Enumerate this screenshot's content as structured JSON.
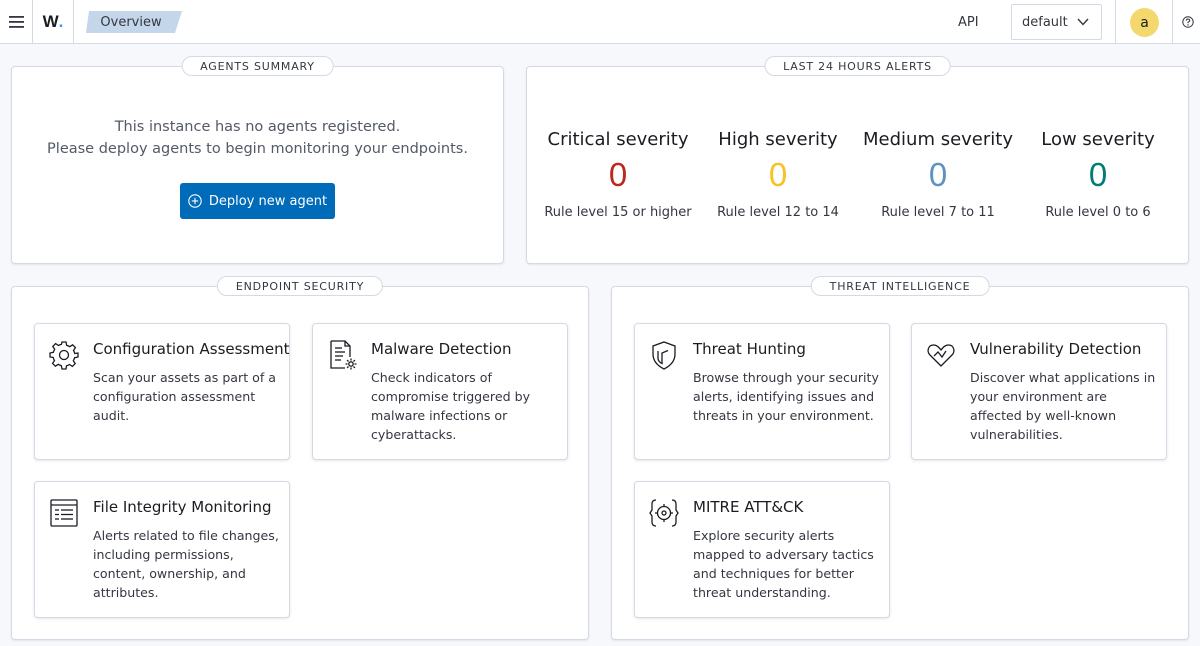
{
  "header": {
    "logo_text": "W",
    "logo_dot": ".",
    "breadcrumb": "Overview",
    "api_label": "API",
    "selector_value": "default",
    "avatar_initial": "a",
    "icons": [
      "menu-icon",
      "chevron-down-icon",
      "help-icon"
    ]
  },
  "agents_summary": {
    "title": "AGENTS SUMMARY",
    "line1": "This instance has no agents registered.",
    "line2": "Please deploy agents to begin monitoring your endpoints.",
    "button_label": "Deploy new agent",
    "button_icon": "plus-circle-icon"
  },
  "alerts": {
    "title": "LAST 24 HOURS ALERTS",
    "items": [
      {
        "label": "Critical severity",
        "value": "0",
        "rule": "Rule level 15 or higher",
        "color": "#bd271e"
      },
      {
        "label": "High severity",
        "value": "0",
        "rule": "Rule level 12 to 14",
        "color": "#f5c324"
      },
      {
        "label": "Medium severity",
        "value": "0",
        "rule": "Rule level 7 to 11",
        "color": "#6092c0"
      },
      {
        "label": "Low severity",
        "value": "0",
        "rule": "Rule level 0 to 6",
        "color": "#017d73"
      }
    ]
  },
  "endpoint_security": {
    "title": "ENDPOINT SECURITY",
    "cards": [
      {
        "title": "Configuration Assessment",
        "desc": "Scan your assets as part of a configuration assessment audit.",
        "icon": "gear-icon"
      },
      {
        "title": "Malware Detection",
        "desc": "Check indicators of compromise triggered by malware infections or cyberattacks.",
        "icon": "document-gear-icon"
      },
      {
        "title": "File Integrity Monitoring",
        "desc": "Alerts related to file changes, including permissions, content, ownership, and attributes.",
        "icon": "list-document-icon"
      }
    ]
  },
  "threat_intelligence": {
    "title": "THREAT INTELLIGENCE",
    "cards": [
      {
        "title": "Threat Hunting",
        "desc": "Browse through your security alerts, identifying issues and threats in your environment.",
        "icon": "shield-icon"
      },
      {
        "title": "Vulnerability Detection",
        "desc": "Discover what applications in your environment are affected by well-known vulnerabilities.",
        "icon": "heart-pulse-icon"
      },
      {
        "title": "MITRE ATT&CK",
        "desc": "Explore security alerts mapped to adversary tactics and techniques for better threat understanding.",
        "icon": "target-icon"
      }
    ]
  }
}
